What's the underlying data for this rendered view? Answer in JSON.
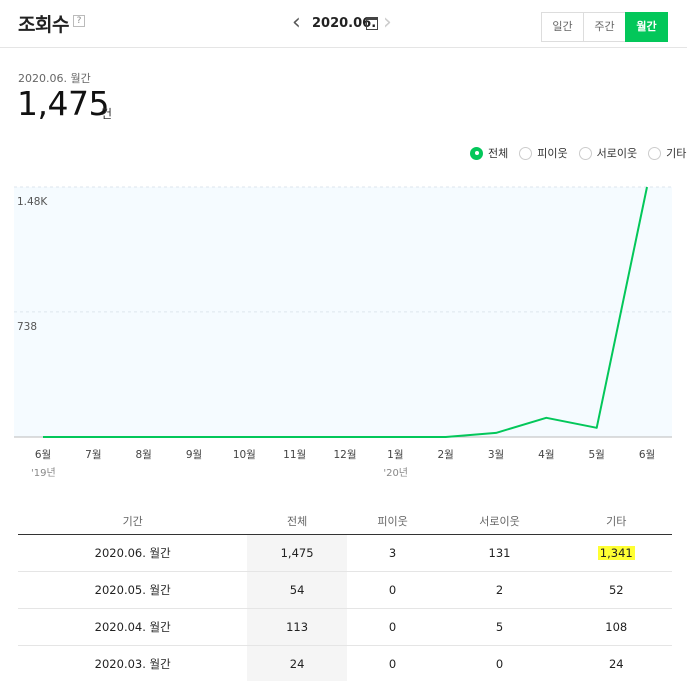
{
  "header": {
    "title": "조회수",
    "help": "?",
    "date": "2020.06.",
    "prev": "‹",
    "next": "›",
    "period_tabs": [
      "일간",
      "주간",
      "월간"
    ],
    "active_period": "월간"
  },
  "summary": {
    "label": "2020.06. 월간",
    "value": "1,475",
    "unit": "건"
  },
  "legend": [
    "전체",
    "피이웃",
    "서로이웃",
    "기타"
  ],
  "legend_selected": "전체",
  "colors": {
    "accent": "#03c75a",
    "highlight": "#ffff33",
    "plot_bg": "#f5fbff"
  },
  "chart_data": {
    "type": "line",
    "categories": [
      "6월",
      "7월",
      "8월",
      "9월",
      "10월",
      "11월",
      "12월",
      "1월",
      "2월",
      "3월",
      "4월",
      "5월",
      "6월"
    ],
    "year_labels": [
      {
        "index": 0,
        "label": "'19년"
      },
      {
        "index": 7,
        "label": "'20년"
      }
    ],
    "ytick_labels": [
      "1.48K",
      "738"
    ],
    "ytick_values": [
      1475,
      738
    ],
    "ylim": [
      0,
      1475
    ],
    "series": [
      {
        "values": [
          0,
          0,
          0,
          0,
          0,
          0,
          0,
          0,
          0,
          24,
          113,
          54,
          1475
        ]
      }
    ],
    "grid": true
  },
  "table": {
    "headers": [
      "기간",
      "전체",
      "피이웃",
      "서로이웃",
      "기타"
    ],
    "rows": [
      [
        "2020.06. 월간",
        "1,475",
        "3",
        "131",
        "1,341"
      ],
      [
        "2020.05. 월간",
        "54",
        "0",
        "2",
        "52"
      ],
      [
        "2020.04. 월간",
        "113",
        "0",
        "5",
        "108"
      ],
      [
        "2020.03. 월간",
        "24",
        "0",
        "0",
        "24"
      ]
    ]
  }
}
